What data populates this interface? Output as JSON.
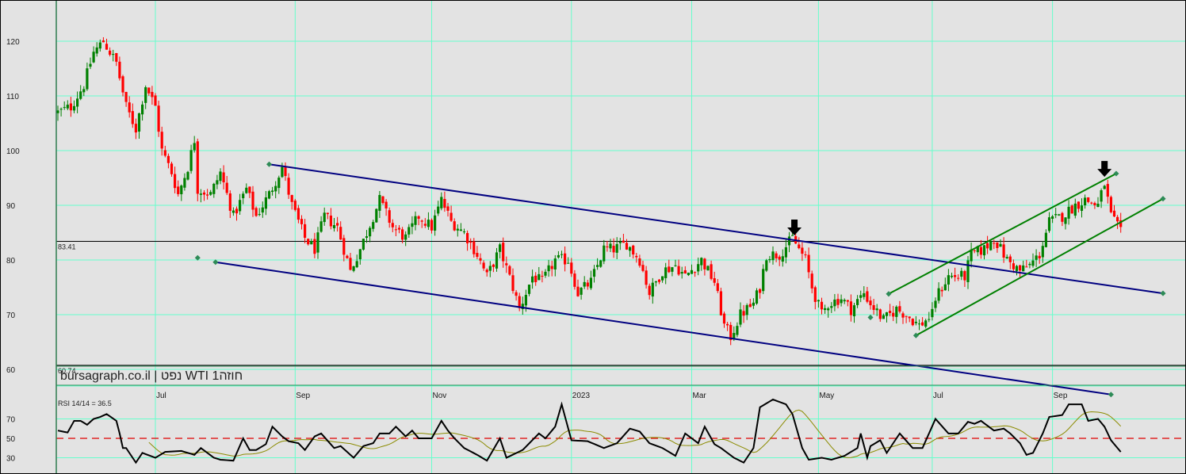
{
  "chart_data": {
    "type": "candlestick",
    "title": "bursagraph.co.il | נפט WTI 1חוזה",
    "price_axis": {
      "ticks": [
        120,
        110,
        100,
        90,
        80,
        70,
        60
      ],
      "range": [
        57,
        127
      ]
    },
    "time_axis": {
      "unit": "trading day index",
      "range": [
        0,
        340
      ],
      "ticks": [
        {
          "label": "Jul",
          "day": 30
        },
        {
          "label": "Sep",
          "day": 73
        },
        {
          "label": "Nov",
          "day": 115
        },
        {
          "label": "2023",
          "day": 158
        },
        {
          "label": "Mar",
          "day": 195
        },
        {
          "label": "May",
          "day": 234
        },
        {
          "label": "Jul",
          "day": 269
        },
        {
          "label": "Sep",
          "day": 306
        }
      ]
    },
    "horizontal_levels": [
      {
        "label": "83.41",
        "value": 83.41
      },
      {
        "label": "60.74",
        "value": 60.74
      }
    ],
    "price_keypoints": [
      [
        0,
        107
      ],
      [
        4,
        108
      ],
      [
        8,
        112
      ],
      [
        11,
        118
      ],
      [
        14,
        120
      ],
      [
        18,
        116
      ],
      [
        21,
        108
      ],
      [
        24,
        104
      ],
      [
        27,
        112
      ],
      [
        30,
        108
      ],
      [
        32,
        100
      ],
      [
        35,
        96
      ],
      [
        37,
        92
      ],
      [
        40,
        97
      ],
      [
        42,
        102
      ],
      [
        43,
        93
      ],
      [
        47,
        92
      ],
      [
        50,
        96
      ],
      [
        54,
        88
      ],
      [
        58,
        93
      ],
      [
        61,
        88
      ],
      [
        65,
        92
      ],
      [
        69,
        97
      ],
      [
        72,
        90
      ],
      [
        76,
        84
      ],
      [
        79,
        82
      ],
      [
        82,
        88
      ],
      [
        86,
        86
      ],
      [
        90,
        78
      ],
      [
        93,
        82
      ],
      [
        97,
        88
      ],
      [
        99,
        91
      ],
      [
        103,
        86
      ],
      [
        107,
        84
      ],
      [
        111,
        88
      ],
      [
        115,
        86
      ],
      [
        118,
        91
      ],
      [
        121,
        87
      ],
      [
        125,
        85
      ],
      [
        129,
        81
      ],
      [
        132,
        77
      ],
      [
        136,
        82
      ],
      [
        140,
        75
      ],
      [
        142,
        71
      ],
      [
        146,
        77
      ],
      [
        149,
        76
      ],
      [
        153,
        80
      ],
      [
        157,
        80
      ],
      [
        160,
        74
      ],
      [
        164,
        76
      ],
      [
        168,
        82
      ],
      [
        171,
        82
      ],
      [
        175,
        83
      ],
      [
        179,
        80
      ],
      [
        182,
        74
      ],
      [
        186,
        78
      ],
      [
        190,
        79
      ],
      [
        193,
        77
      ],
      [
        198,
        80
      ],
      [
        202,
        76
      ],
      [
        205,
        68
      ],
      [
        207,
        66
      ],
      [
        210,
        70
      ],
      [
        214,
        72
      ],
      [
        216,
        75
      ],
      [
        218,
        81
      ],
      [
        222,
        81
      ],
      [
        226,
        84
      ],
      [
        230,
        80
      ],
      [
        232,
        75
      ],
      [
        235,
        70
      ],
      [
        237,
        72
      ],
      [
        241,
        73
      ],
      [
        244,
        71
      ],
      [
        248,
        74
      ],
      [
        250,
        72
      ],
      [
        254,
        69
      ],
      [
        258,
        71
      ],
      [
        261,
        70
      ],
      [
        265,
        68
      ],
      [
        269,
        70
      ],
      [
        270,
        73
      ],
      [
        274,
        77
      ],
      [
        279,
        77
      ],
      [
        281,
        81
      ],
      [
        285,
        82
      ],
      [
        288,
        84
      ],
      [
        292,
        80
      ],
      [
        296,
        78
      ],
      [
        299,
        79
      ],
      [
        302,
        81
      ],
      [
        305,
        87
      ],
      [
        309,
        88
      ],
      [
        313,
        90
      ],
      [
        316,
        91
      ],
      [
        320,
        90
      ],
      [
        322,
        94
      ],
      [
        324,
        88
      ],
      [
        327,
        85
      ]
    ],
    "trendlines": [
      {
        "name": "channel-upper",
        "color": "#000080",
        "from": [
          65,
          97.5
        ],
        "to": [
          340,
          73.9
        ]
      },
      {
        "name": "channel-lower",
        "color": "#000080",
        "from": [
          48.5,
          79.6
        ],
        "to": [
          324,
          55.4
        ]
      },
      {
        "name": "rising-lower",
        "color": "#008000",
        "from": [
          264,
          66.2
        ],
        "to": [
          340,
          91.2
        ]
      },
      {
        "name": "rising-upper",
        "color": "#008000",
        "from": [
          255.6,
          73.8
        ],
        "to": [
          325.6,
          95.8
        ]
      }
    ],
    "markers": [
      [
        43,
        80.4
      ],
      [
        250,
        69.5
      ]
    ],
    "arrows": [
      {
        "day": 226.6,
        "price": 84.5
      },
      {
        "day": 322,
        "price": 95.2
      }
    ],
    "rsi": {
      "label": "RSI 14/14 = 36.5",
      "ticks": [
        70,
        50,
        30
      ],
      "levels": [
        70,
        50,
        30
      ],
      "ma_period": 14,
      "keypoints": [
        [
          0,
          58
        ],
        [
          3,
          56
        ],
        [
          5,
          68
        ],
        [
          7,
          68
        ],
        [
          9,
          64
        ],
        [
          11,
          70
        ],
        [
          13,
          72
        ],
        [
          15,
          75
        ],
        [
          18,
          68
        ],
        [
          19,
          55
        ],
        [
          20,
          40
        ],
        [
          21,
          40
        ],
        [
          24,
          25
        ],
        [
          26,
          35
        ],
        [
          30,
          30
        ],
        [
          33,
          36
        ],
        [
          38,
          37
        ],
        [
          42,
          33
        ],
        [
          44,
          40
        ],
        [
          48,
          30
        ],
        [
          50,
          28
        ],
        [
          54,
          27
        ],
        [
          57,
          50
        ],
        [
          59,
          38
        ],
        [
          61,
          38
        ],
        [
          64,
          44
        ],
        [
          66,
          62
        ],
        [
          69,
          52
        ],
        [
          71,
          47
        ],
        [
          74,
          45
        ],
        [
          76,
          38
        ],
        [
          79,
          52
        ],
        [
          81,
          55
        ],
        [
          85,
          40
        ],
        [
          87,
          42
        ],
        [
          91,
          30
        ],
        [
          94,
          42
        ],
        [
          97,
          45
        ],
        [
          99,
          55
        ],
        [
          102,
          55
        ],
        [
          104,
          62
        ],
        [
          107,
          52
        ],
        [
          109,
          58
        ],
        [
          111,
          50
        ],
        [
          115,
          50
        ],
        [
          118,
          68
        ],
        [
          120,
          58
        ],
        [
          122,
          50
        ],
        [
          125,
          40
        ],
        [
          129,
          33
        ],
        [
          132,
          27
        ],
        [
          136,
          50
        ],
        [
          138,
          30
        ],
        [
          143,
          38
        ],
        [
          148,
          55
        ],
        [
          150,
          50
        ],
        [
          153,
          62
        ],
        [
          155,
          85
        ],
        [
          158,
          48
        ],
        [
          163,
          47
        ],
        [
          168,
          40
        ],
        [
          172,
          45
        ],
        [
          176,
          60
        ],
        [
          179,
          57
        ],
        [
          182,
          45
        ],
        [
          186,
          40
        ],
        [
          190,
          32
        ],
        [
          193,
          55
        ],
        [
          197,
          45
        ],
        [
          199,
          62
        ],
        [
          202,
          44
        ],
        [
          204,
          40
        ],
        [
          208,
          30
        ],
        [
          211,
          25
        ],
        [
          214,
          40
        ],
        [
          216,
          82
        ],
        [
          220,
          90
        ],
        [
          224,
          85
        ],
        [
          226,
          75
        ],
        [
          229,
          40
        ],
        [
          231,
          28
        ],
        [
          235,
          30
        ],
        [
          238,
          28
        ],
        [
          242,
          32
        ],
        [
          246,
          40
        ],
        [
          247,
          55
        ],
        [
          249,
          30
        ],
        [
          250,
          42
        ],
        [
          253,
          48
        ],
        [
          255,
          35
        ],
        [
          259,
          55
        ],
        [
          263,
          40
        ],
        [
          266,
          40
        ],
        [
          270,
          70
        ],
        [
          274,
          55
        ],
        [
          277,
          55
        ],
        [
          280,
          67
        ],
        [
          282,
          65
        ],
        [
          284,
          68
        ],
        [
          288,
          58
        ],
        [
          291,
          60
        ],
        [
          293,
          55
        ],
        [
          296,
          45
        ],
        [
          298,
          33
        ],
        [
          300,
          35
        ],
        [
          303,
          55
        ],
        [
          305,
          72
        ],
        [
          309,
          74
        ],
        [
          311,
          85
        ],
        [
          315,
          85
        ],
        [
          317,
          68
        ],
        [
          320,
          70
        ],
        [
          322,
          62
        ],
        [
          324,
          48
        ],
        [
          327,
          36
        ]
      ]
    },
    "colors": {
      "up": "#008000",
      "down": "#ff0000",
      "grid": "#66ffcc",
      "rsi": "#000000",
      "rsi_ma": "#8b8b00",
      "rsi_mid": "#e00000"
    }
  }
}
